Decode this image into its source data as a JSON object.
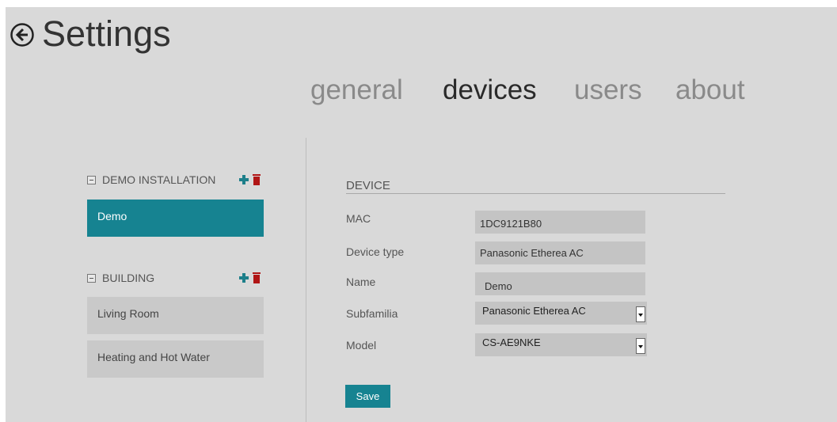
{
  "header": {
    "title": "Settings",
    "back_icon": "arrow-left-circle-icon"
  },
  "tabs": [
    {
      "label": "general",
      "active": false
    },
    {
      "label": "devices",
      "active": true
    },
    {
      "label": "users",
      "active": false
    },
    {
      "label": "about",
      "active": false
    }
  ],
  "sidebar": {
    "groups": [
      {
        "label": "DEMO INSTALLATION",
        "items": [
          {
            "label": "Demo",
            "selected": true
          }
        ]
      },
      {
        "label": "BUILDING",
        "items": [
          {
            "label": "Living Room",
            "selected": false
          },
          {
            "label": "Heating and Hot Water",
            "selected": false
          }
        ]
      }
    ]
  },
  "device": {
    "section_title": "DEVICE",
    "fields": [
      {
        "label": "MAC",
        "value": "1DC9121B80"
      },
      {
        "label": "Device type",
        "value": "Panasonic Etherea AC"
      },
      {
        "label": "Name",
        "value": "Demo"
      },
      {
        "label": "Subfamilia",
        "value": "Panasonic Etherea AC"
      },
      {
        "label": "Model",
        "value": "CS-AE9NKE"
      }
    ],
    "save_label": "Save"
  },
  "colors": {
    "accent": "#168391",
    "delete": "#b01515",
    "panel_bg": "#d9d9d9"
  }
}
